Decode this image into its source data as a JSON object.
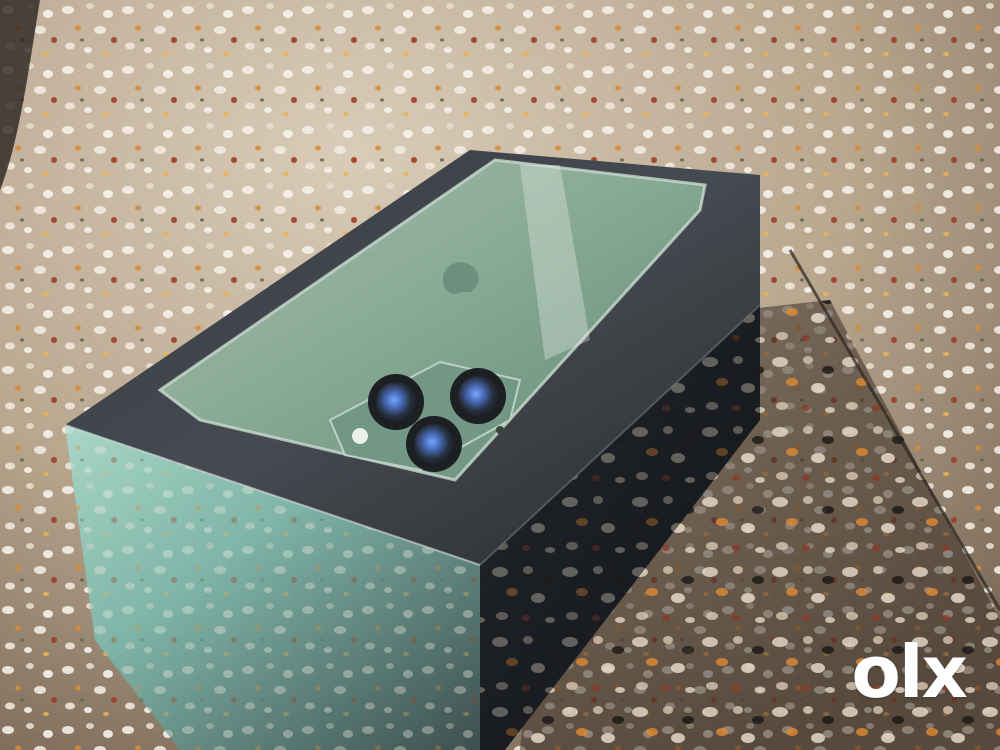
{
  "image": {
    "subject": "green-smartphone-box",
    "colors": {
      "floor_base": "#b9a78f",
      "floor_shadow": "#3a2f27",
      "box_dark": "#1f2227",
      "box_side_reflection": "#8bc2b0",
      "phone_green": "#7fa38d",
      "phone_green_dark": "#4f7565",
      "lens_blue": "#4a78c8",
      "watermark": "#ffffff"
    }
  },
  "watermark": {
    "text": "olx",
    "icon": "olx-logo"
  }
}
